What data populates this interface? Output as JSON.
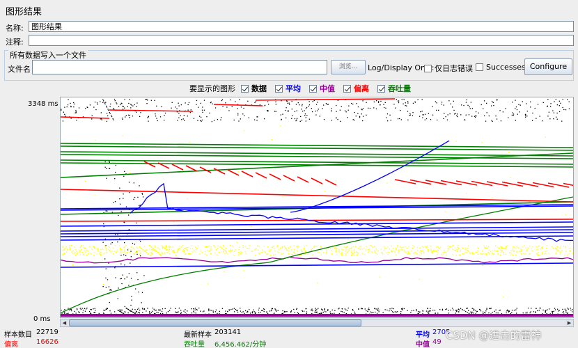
{
  "panel": {
    "title": "图形结果",
    "name_label": "名称:",
    "name_value": "图形结果",
    "comment_label": "注释:",
    "comment_value": ""
  },
  "file": {
    "section_label": "所有数据写入一个文件",
    "filename_label": "文件名",
    "filename_value": "",
    "browse_label": "浏览...",
    "log_display_label": "Log/Display Only:",
    "errors_only_label": "仅日志错误",
    "successes_label": "Successes",
    "configure_label": "Configure"
  },
  "legend": {
    "prompt": "要显示的图形",
    "items": [
      {
        "label": "数据",
        "color": "#000000",
        "checked": true
      },
      {
        "label": "平均",
        "color": "#0000ff",
        "checked": true
      },
      {
        "label": "中值",
        "color": "#990099",
        "checked": true
      },
      {
        "label": "偏离",
        "color": "#ff0000",
        "checked": true
      },
      {
        "label": "吞吐量",
        "color": "#008000",
        "checked": true
      }
    ]
  },
  "chart_data": {
    "type": "scatter",
    "y_max_label": "3348  ms",
    "y_min_label": "0  ms",
    "ylim": [
      0,
      3348
    ],
    "unit": "ms",
    "series_colors": {
      "data": "#000000",
      "average": "#0000ff",
      "median": "#990099",
      "deviation": "#ff0000",
      "throughput": "#008000",
      "latest": "#ffff00"
    }
  },
  "stats": {
    "samples_label": "样本数目",
    "samples_value": "22719",
    "deviation_label": "偏离",
    "deviation_value": "16626",
    "latest_label": "最新样本",
    "latest_value": "203141",
    "throughput_label": "吞吐量",
    "throughput_value": "6,456.462/分钟",
    "average_label": "平均",
    "average_value": "2705",
    "median_label": "中值",
    "median_value": "49"
  },
  "watermark": "CSDN @进击的雷神"
}
